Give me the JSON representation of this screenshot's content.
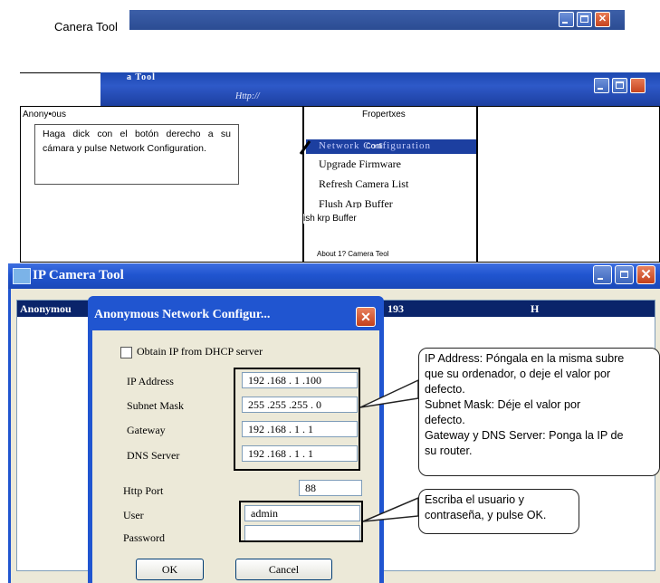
{
  "top_window": {
    "title": "Canera Tool"
  },
  "mid": {
    "bar_title": "a Tool",
    "bar_subtitle": "Http://",
    "anon_label": "Anony•ous",
    "callout": "Haga dick con el botón derecho a su cámara y pulse Network Configuration.",
    "context_menu": {
      "header": "Fropertxes",
      "highlight": "Network Configuration",
      "highlight_overlay": "Confi",
      "items": [
        "Upgrade Firmware",
        "Refresh Camera List",
        "Flush Arp Buffer"
      ],
      "flush_cut": "ish krp Buffer",
      "about": "About 1? Camera Teol"
    }
  },
  "main_window": {
    "title": "IP Camera Tool",
    "list": {
      "col1": "Anonymou",
      "col2": "193",
      "col3": "H"
    },
    "dialog": {
      "title": "Anonymous Network Configur...",
      "dhcp_label": "Obtain IP from DHCP server",
      "ip_label": "IP Address",
      "ip_value": "192 .168 . 1 .100",
      "mask_label": "Subnet Mask",
      "mask_value": "255 .255 .255 . 0",
      "gateway_label": "Gateway",
      "gateway_value": "192 .168 . 1 . 1",
      "dns_label": "DNS Server",
      "dns_value": "192 .168 . 1 . 1",
      "http_label": "Http Port",
      "http_value": "88",
      "user_label": "User",
      "user_value": "admin",
      "password_label": "Password",
      "password_value": "",
      "ok_label": "OK",
      "cancel_label": "Cancel"
    }
  },
  "callouts": {
    "ip_help": [
      "IP Address: Póngala en la misma subre",
      "que su ordenador, o deje el valor por",
      "defecto.",
      "Subnet Mask: Déje el valor por",
      "defecto.",
      "Gateway y DNS Server: Ponga la IP de",
      "su router."
    ],
    "user_help": [
      "Escriba el usuario y",
      "contraseña, y pulse OK."
    ]
  },
  "colors": {
    "titlebar": "#2055d0",
    "close": "#c6441e",
    "selection": "#0a246a"
  }
}
